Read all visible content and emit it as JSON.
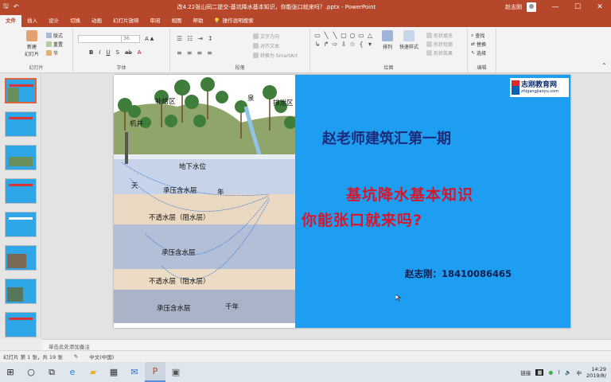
{
  "titlebar": {
    "doc_title": "改4.22张山同二提交-基坑降水基本知识，你能张口就来吗？.pptx - PowerPoint",
    "user": "赵志刚",
    "save_icon": "save-icon",
    "undo_icon": "undo-icon",
    "minimize": "—",
    "maximize": "☐",
    "close": "✕"
  },
  "tabs": [
    "文件",
    "插入",
    "设计",
    "切换",
    "动画",
    "幻灯片放映",
    "审阅",
    "视图",
    "帮助"
  ],
  "tell_me": "操作说明搜索",
  "ribbon": {
    "slides_group": "幻灯片",
    "new_slide": "新建\n幻灯片",
    "layout": "版式",
    "reset": "重置",
    "section": "节",
    "font_group": "字体",
    "font_size": "36",
    "paragraph_group": "段落",
    "text_direction": "文字方向",
    "align_text": "对齐文本",
    "convert_smartart": "转换为 SmartArt",
    "drawing_group": "绘图",
    "arrange": "排列",
    "quick_styles": "快速样式",
    "shape_fill": "形状填充",
    "shape_outline": "形状轮廓",
    "shape_effects": "形状效果",
    "editing_group": "编辑",
    "find": "查找",
    "replace": "替换",
    "select": "选择"
  },
  "thumbnails": [
    {
      "num": "1"
    },
    {
      "num": "2"
    },
    {
      "num": "3"
    },
    {
      "num": "4"
    },
    {
      "num": "5"
    },
    {
      "num": "6"
    },
    {
      "num": "7"
    },
    {
      "num": "8"
    },
    {
      "num": "9"
    }
  ],
  "slide": {
    "diagram_labels": {
      "recharge": "补给区",
      "discharge": "排泄区",
      "well": "机井",
      "water_table": "地下水位",
      "tian": "天",
      "confined_aquifer_1": "承压含水层",
      "impermeable_1": "不透水层（阻水层）",
      "confined_aquifer_2": "承压含水层",
      "impermeable_2": "不透水层（阻水层）",
      "confined_aquifer_3": "承压含水层",
      "year": "年",
      "thousand_years": "千年",
      "spring": "泉"
    },
    "logo_main": "志刚教育网",
    "logo_sub": "zhigangjiaoyu.com",
    "heading": "赵老师建筑汇第一期",
    "title_line1": "基坑降水基本知识",
    "title_line2": "你能张口就来吗?",
    "contact": "赵志刚：18410086465"
  },
  "notes_placeholder": "单击此处添加备注",
  "statusbar": {
    "slide_info": "幻灯片 第 1 张，共 19 张",
    "language": "中文(中国)"
  },
  "taskbar": {
    "time": "14:29",
    "date": "2019/8/",
    "tray_text_1": "链接",
    "tray_text_2": "中"
  }
}
